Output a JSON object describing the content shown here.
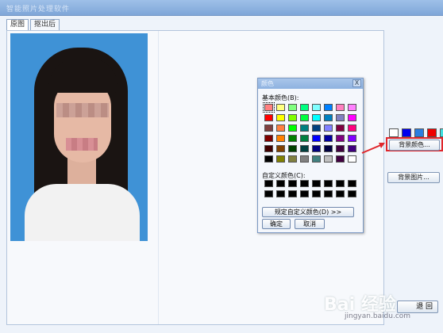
{
  "window": {
    "title": "智能照片处理软件"
  },
  "tabs": [
    {
      "label": "原图"
    },
    {
      "label": "抠出后"
    }
  ],
  "dialog": {
    "title": "颜色",
    "close": "X",
    "basic_label": "基本颜色(B):",
    "custom_label": "自定义颜色(C):",
    "define_custom": "规定自定义颜色(D) >>",
    "ok": "确定",
    "cancel": "取消",
    "basic_colors": [
      "#ff8080",
      "#ffff80",
      "#80ff80",
      "#00ff80",
      "#80ffff",
      "#0080ff",
      "#ff80c0",
      "#ff80ff",
      "#ff0000",
      "#ffff00",
      "#80ff00",
      "#00ff40",
      "#00ffff",
      "#0080c0",
      "#8080c0",
      "#ff00ff",
      "#804040",
      "#ff8040",
      "#00ff00",
      "#008080",
      "#004080",
      "#8080ff",
      "#800040",
      "#ff0080",
      "#800000",
      "#ff8000",
      "#008000",
      "#008040",
      "#0000ff",
      "#0000a0",
      "#800080",
      "#8000ff",
      "#400000",
      "#804000",
      "#004000",
      "#004040",
      "#000080",
      "#000040",
      "#400040",
      "#400080",
      "#000000",
      "#808000",
      "#808040",
      "#808080",
      "#408080",
      "#c0c0c0",
      "#400040",
      "#ffffff"
    ],
    "custom_colors_count_note": ""
  },
  "color_strip": [
    "#ffffff",
    "#0000ee",
    "#2a7de0",
    "#ee0000",
    "#40e0e0"
  ],
  "right_buttons": {
    "bg_color": "背景颜色...",
    "bg_image": "背景图片..."
  },
  "bottom_button": "退 回",
  "watermark": {
    "brand": "Bai 经验",
    "site": "jingyan.baidu.com"
  }
}
